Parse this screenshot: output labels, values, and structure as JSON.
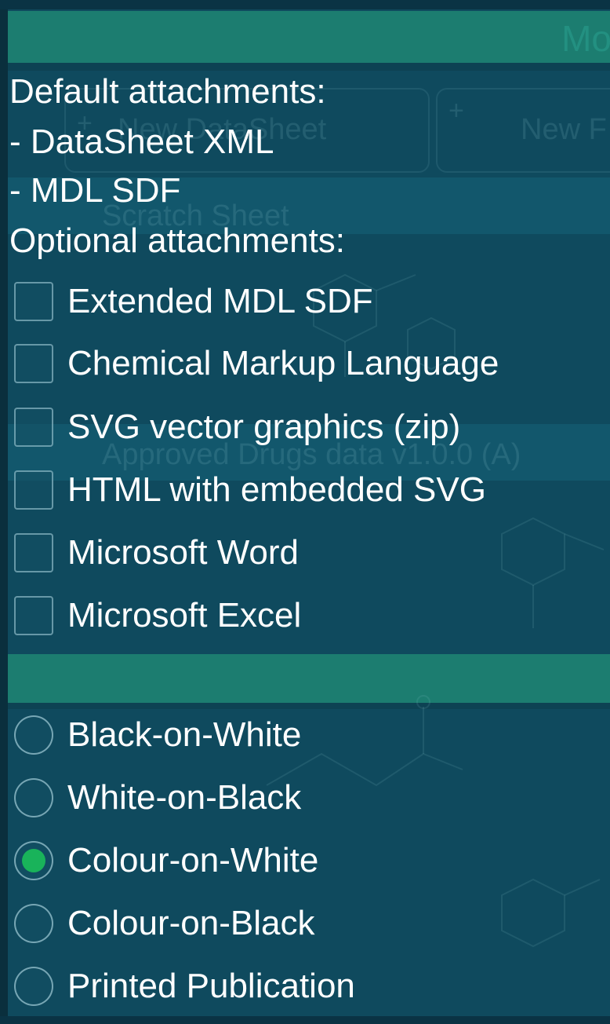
{
  "colors": {
    "background": "#0f4a5e",
    "header_bar": "#1c7d70",
    "text": "#ffffff",
    "radio_selected": "#19b35a"
  },
  "background_ghosts": {
    "header_title": "Mo",
    "new_datasheet": "New DataSheet",
    "new_other": "New F",
    "section_one": "Scratch Sheet",
    "section_two": "Approved Drugs data v1.0.0 (A)"
  },
  "default_attachments": {
    "heading": "Default attachments:",
    "items": [
      "- DataSheet XML",
      "- MDL SDF"
    ]
  },
  "optional_attachments": {
    "heading": "Optional attachments:",
    "items": [
      {
        "label": "Extended MDL SDF",
        "checked": false
      },
      {
        "label": "Chemical Markup Language",
        "checked": false
      },
      {
        "label": "SVG vector graphics (zip)",
        "checked": false
      },
      {
        "label": "HTML with embedded SVG",
        "checked": false
      },
      {
        "label": "Microsoft Word",
        "checked": false
      },
      {
        "label": "Microsoft Excel",
        "checked": false
      }
    ]
  },
  "color_scheme": {
    "options": [
      {
        "label": "Black-on-White",
        "selected": false
      },
      {
        "label": "White-on-Black",
        "selected": false
      },
      {
        "label": "Colour-on-White",
        "selected": true
      },
      {
        "label": "Colour-on-Black",
        "selected": false
      },
      {
        "label": "Printed Publication",
        "selected": false
      }
    ]
  }
}
